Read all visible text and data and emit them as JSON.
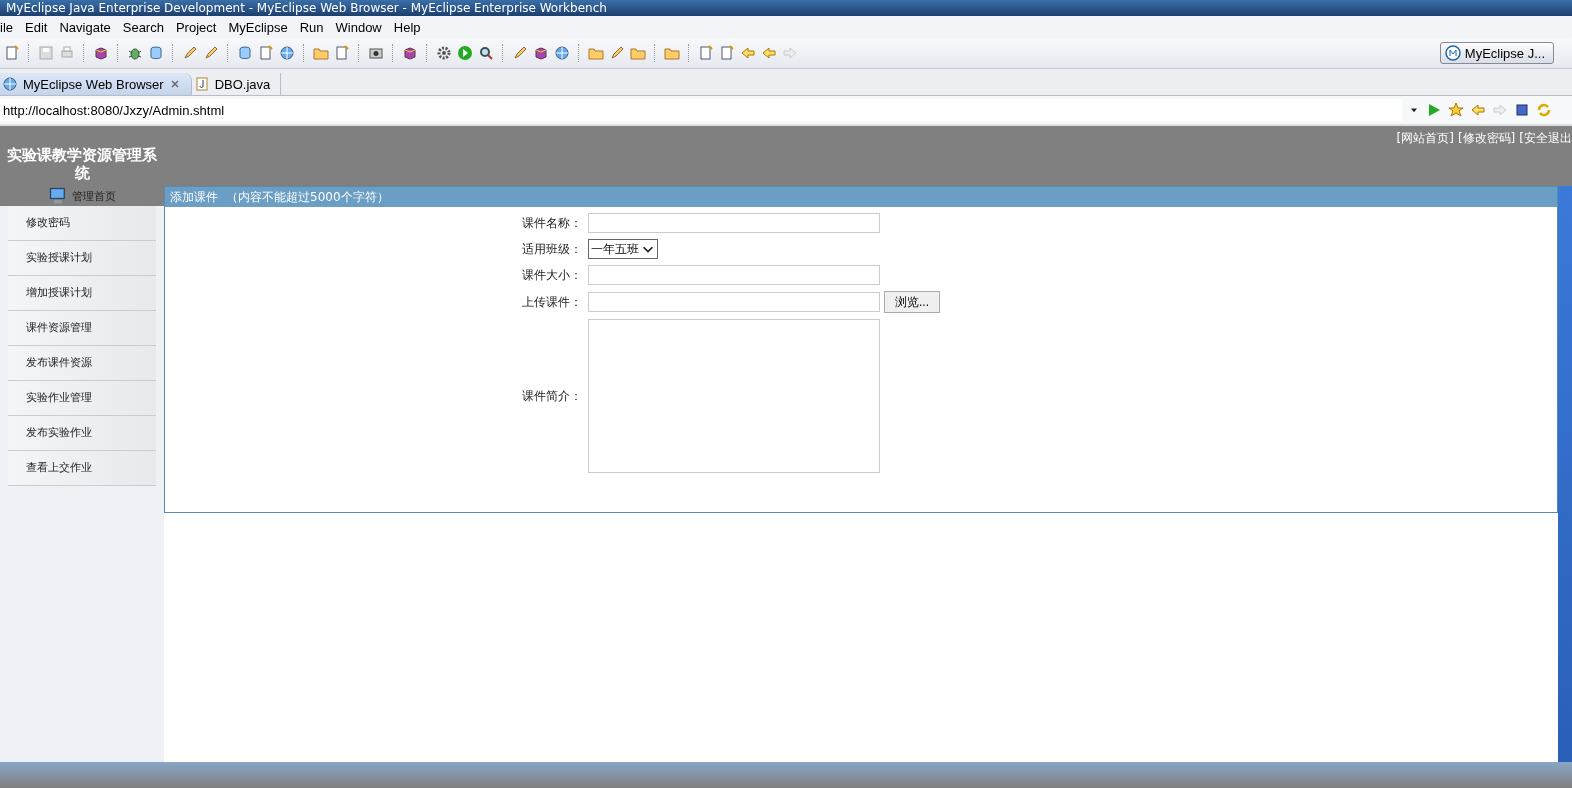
{
  "window": {
    "title": "MyEclipse Java Enterprise Development - MyEclipse Web Browser - MyEclipse Enterprise Workbench"
  },
  "menu": [
    "ile",
    "Edit",
    "Navigate",
    "Search",
    "Project",
    "MyEclipse",
    "Run",
    "Window",
    "Help"
  ],
  "perspective": {
    "label": "MyEclipse J..."
  },
  "editor_tabs": [
    {
      "label": "MyEclipse Web Browser",
      "selected": true,
      "kind": "browser"
    },
    {
      "label": "DBO.java",
      "selected": false,
      "kind": "java"
    }
  ],
  "address_bar": {
    "value": "http://localhost:8080/Jxzy/Admin.shtml"
  },
  "page": {
    "site_title": "实验课教学资源管理系统",
    "top_links": [
      "[网站首页]",
      "[修改密码]",
      "[安全退出"
    ],
    "home_link": "管理首页",
    "sidebar": [
      {
        "label": "修改密码",
        "selected": false
      },
      {
        "label": "实验授课计划",
        "selected": false
      },
      {
        "label": "增加授课计划",
        "selected": false
      },
      {
        "label": "课件资源管理",
        "selected": false
      },
      {
        "label": "发布课件资源",
        "selected": false
      },
      {
        "label": "实验作业管理",
        "selected": false
      },
      {
        "label": "发布实验作业",
        "selected": false
      },
      {
        "label": "查看上交作业",
        "selected": false
      }
    ],
    "panel": {
      "title": "添加课件",
      "note": "（内容不能超过5000个字符）",
      "fields": [
        {
          "label": "课件名称：",
          "kind": "text"
        },
        {
          "label": "适用班级：",
          "kind": "select",
          "value": "一年五班"
        },
        {
          "label": "课件大小：",
          "kind": "text"
        },
        {
          "label": "上传课件：",
          "kind": "file",
          "button": "浏览..."
        },
        {
          "label": "课件简介：",
          "kind": "textarea"
        }
      ]
    }
  }
}
